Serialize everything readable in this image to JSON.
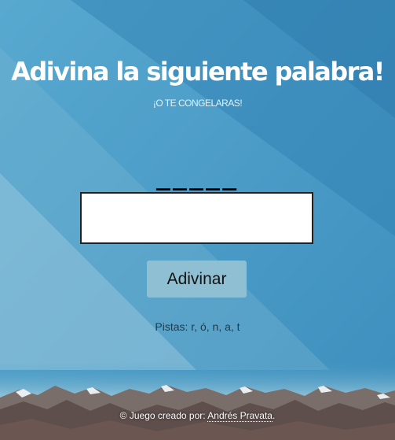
{
  "header": {
    "title": "Adivina la siguiente palabra!",
    "subtitle": "¡O TE CONGELARAS!"
  },
  "game": {
    "blanks": "_____",
    "input_value": "",
    "button_label": "Adivinar",
    "hints": "Pistas: r, ó, n, a, t"
  },
  "footer": {
    "prefix": "© Juego creado por: ",
    "author": "Andrés Pravata",
    "suffix": "."
  },
  "colors": {
    "background": "#4a9cc6",
    "button": "#8fbfd2",
    "text": "#ffffff"
  },
  "icons": [
    "mountain-range-image"
  ]
}
